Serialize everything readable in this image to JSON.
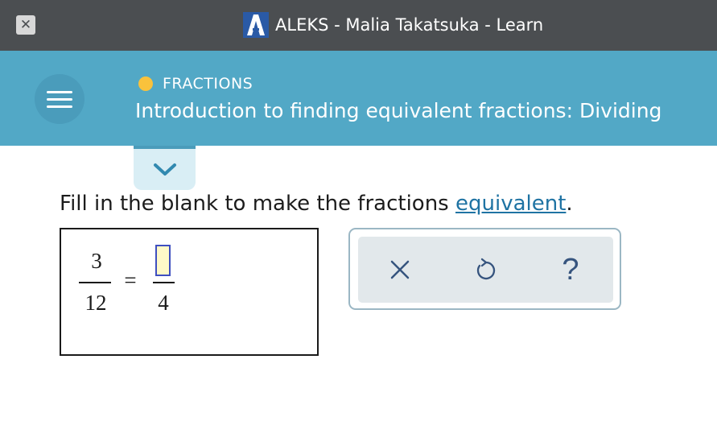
{
  "window": {
    "title": "ALEKS - Malia Takatsuka - Learn",
    "close_icon": "close-icon",
    "logo_letter": "A"
  },
  "topic": {
    "category": "FRACTIONS",
    "title": "Introduction to finding equivalent fractions: Dividing",
    "status_color": "#f9c23c"
  },
  "question": {
    "prompt_before": "Fill in the blank to make the fractions ",
    "prompt_link": "equivalent",
    "prompt_after": ".",
    "left_numerator": "3",
    "left_denominator": "12",
    "equals": "=",
    "right_numerator": "",
    "right_denominator": "4"
  },
  "tools": {
    "clear_icon": "x-icon",
    "undo_icon": "undo-icon",
    "help_label": "?"
  },
  "colors": {
    "titlebar": "#4b4e51",
    "header": "#52a8c6",
    "link": "#1f73a3",
    "tool_icon": "#36547e"
  }
}
